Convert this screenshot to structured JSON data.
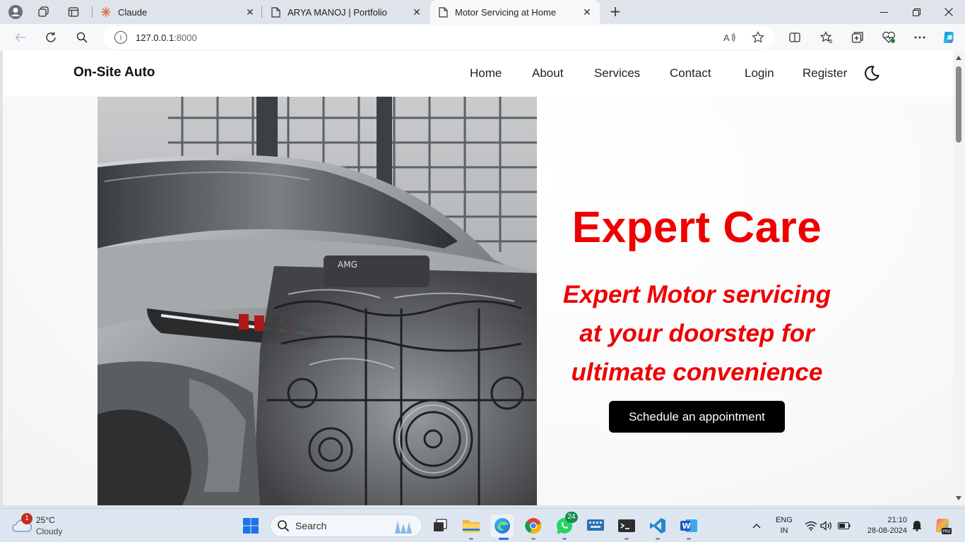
{
  "browser": {
    "tabs": [
      {
        "title": "Claude",
        "active": false
      },
      {
        "title": "ARYA MANOJ | Portfolio",
        "active": false
      },
      {
        "title": "Motor Servicing at Home",
        "active": true
      }
    ],
    "address": {
      "host": "127.0.0.1",
      "port": ":8000"
    }
  },
  "site": {
    "brand": "On-Site Auto",
    "nav": [
      "Home",
      "About",
      "Services",
      "Contact",
      "Login",
      "Register"
    ],
    "hero": {
      "title": "Expert Care",
      "subtitle_lines": [
        "Expert Motor servicing",
        "at your doorstep for",
        "ultimate convenience"
      ],
      "cta_label": "Schedule an appointment"
    },
    "accent_color": "#ee0000"
  },
  "taskbar": {
    "weather": {
      "temp": "25°C",
      "condition": "Cloudy",
      "badge": "1"
    },
    "search_placeholder": "Search",
    "whatsapp_badge": "24",
    "language": {
      "line1": "ENG",
      "line2": "IN"
    },
    "clock": {
      "time": "21:10",
      "date": "28-08-2024"
    }
  }
}
